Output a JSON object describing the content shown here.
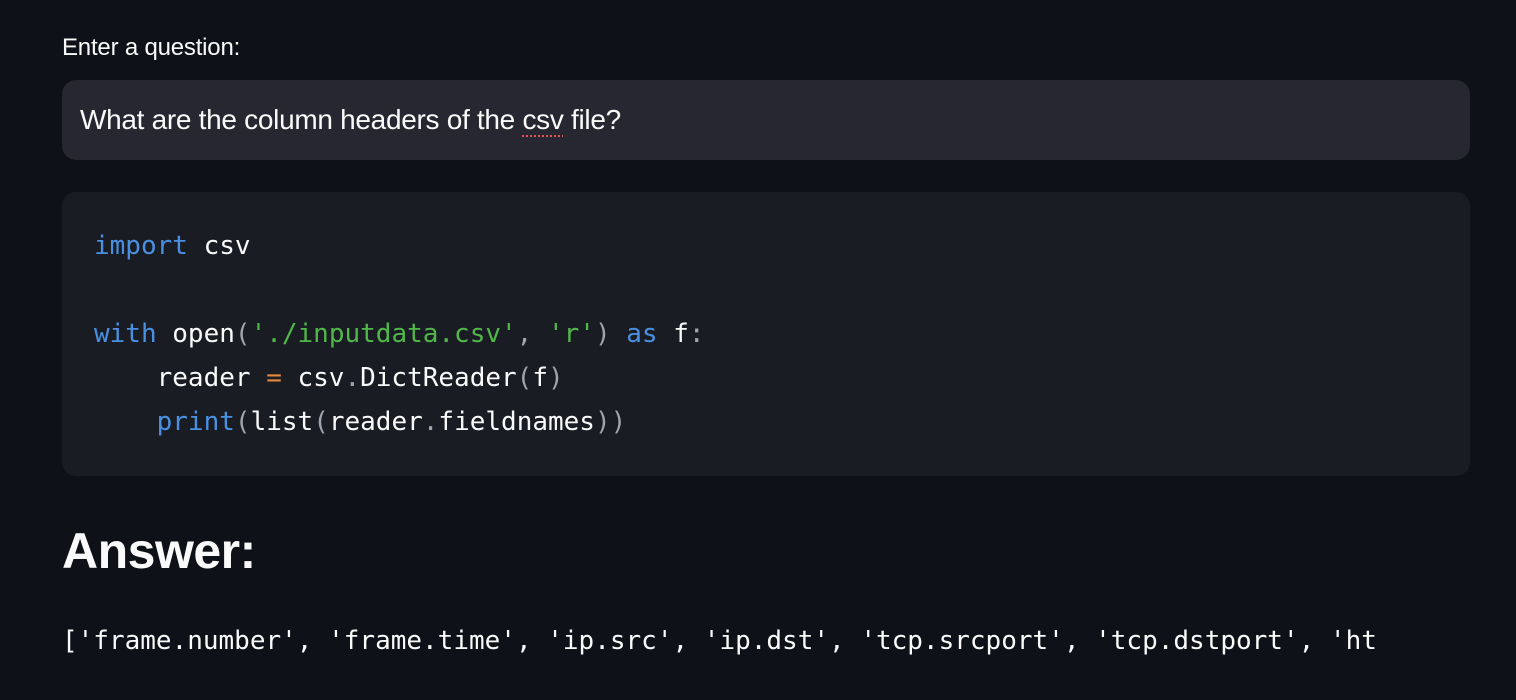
{
  "question": {
    "label": "Enter a question:",
    "value_before": "What are the column headers of the ",
    "value_flagged": "csv",
    "value_after": " file?"
  },
  "code": {
    "lines": [
      "import csv",
      "",
      "with open('./inputdata.csv', 'r') as f:",
      "    reader = csv.DictReader(f)",
      "    print(list(reader.fieldnames))"
    ]
  },
  "answer": {
    "heading": "Answer:",
    "text": "['frame.number', 'frame.time', 'ip.src', 'ip.dst', 'tcp.srcport', 'tcp.dstport', 'ht"
  },
  "colors": {
    "background": "#0e1117",
    "input_bg": "#262730",
    "code_bg": "#1a1c24",
    "keyword": "#4a90e2",
    "string": "#50b848",
    "operator": "#e8883a"
  }
}
